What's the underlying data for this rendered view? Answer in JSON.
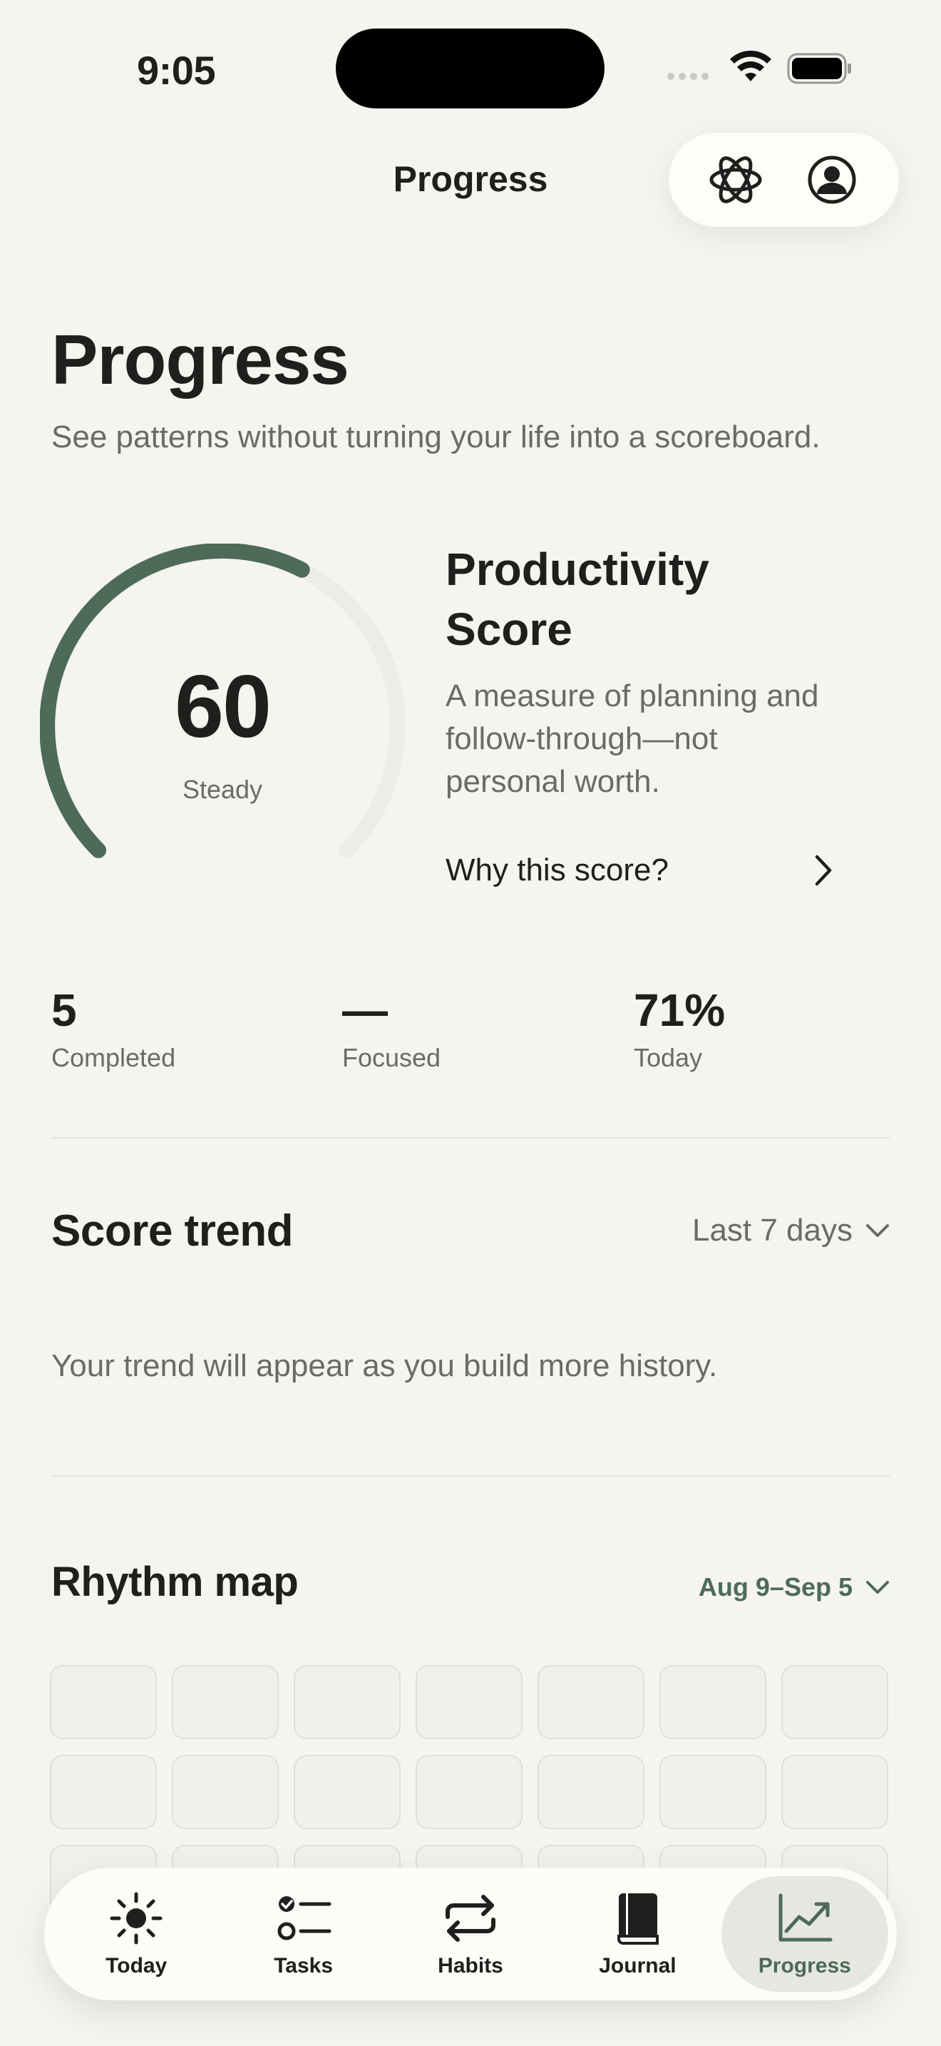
{
  "status_bar": {
    "time": "9:05"
  },
  "nav": {
    "title": "Progress",
    "actions": [
      "ai-assistant-icon",
      "profile-icon"
    ]
  },
  "header": {
    "title": "Progress",
    "subtitle": "See patterns without turning your life into a scoreboard."
  },
  "score": {
    "value": "60",
    "level": 0.6,
    "status": "Steady",
    "title": "Productivity Score",
    "description": "A measure of planning and follow-through—not personal worth.",
    "why_label": "Why this score?",
    "accent": "#4d6b58"
  },
  "stats": [
    {
      "value": "5",
      "label": "Completed"
    },
    {
      "value": "—",
      "label": "Focused"
    },
    {
      "value": "71%",
      "label": "Today"
    }
  ],
  "trend": {
    "title": "Score trend",
    "range": "Last 7 days",
    "empty_message": "Your trend will appear as you build more history."
  },
  "rhythm": {
    "title": "Rhythm map",
    "range": "Aug 9–Sep 5"
  },
  "tabs": [
    {
      "label": "Today",
      "icon": "sun-icon"
    },
    {
      "label": "Tasks",
      "icon": "checklist-icon"
    },
    {
      "label": "Habits",
      "icon": "repeat-icon"
    },
    {
      "label": "Journal",
      "icon": "book-icon"
    },
    {
      "label": "Progress",
      "icon": "chart-icon",
      "active": true
    }
  ]
}
